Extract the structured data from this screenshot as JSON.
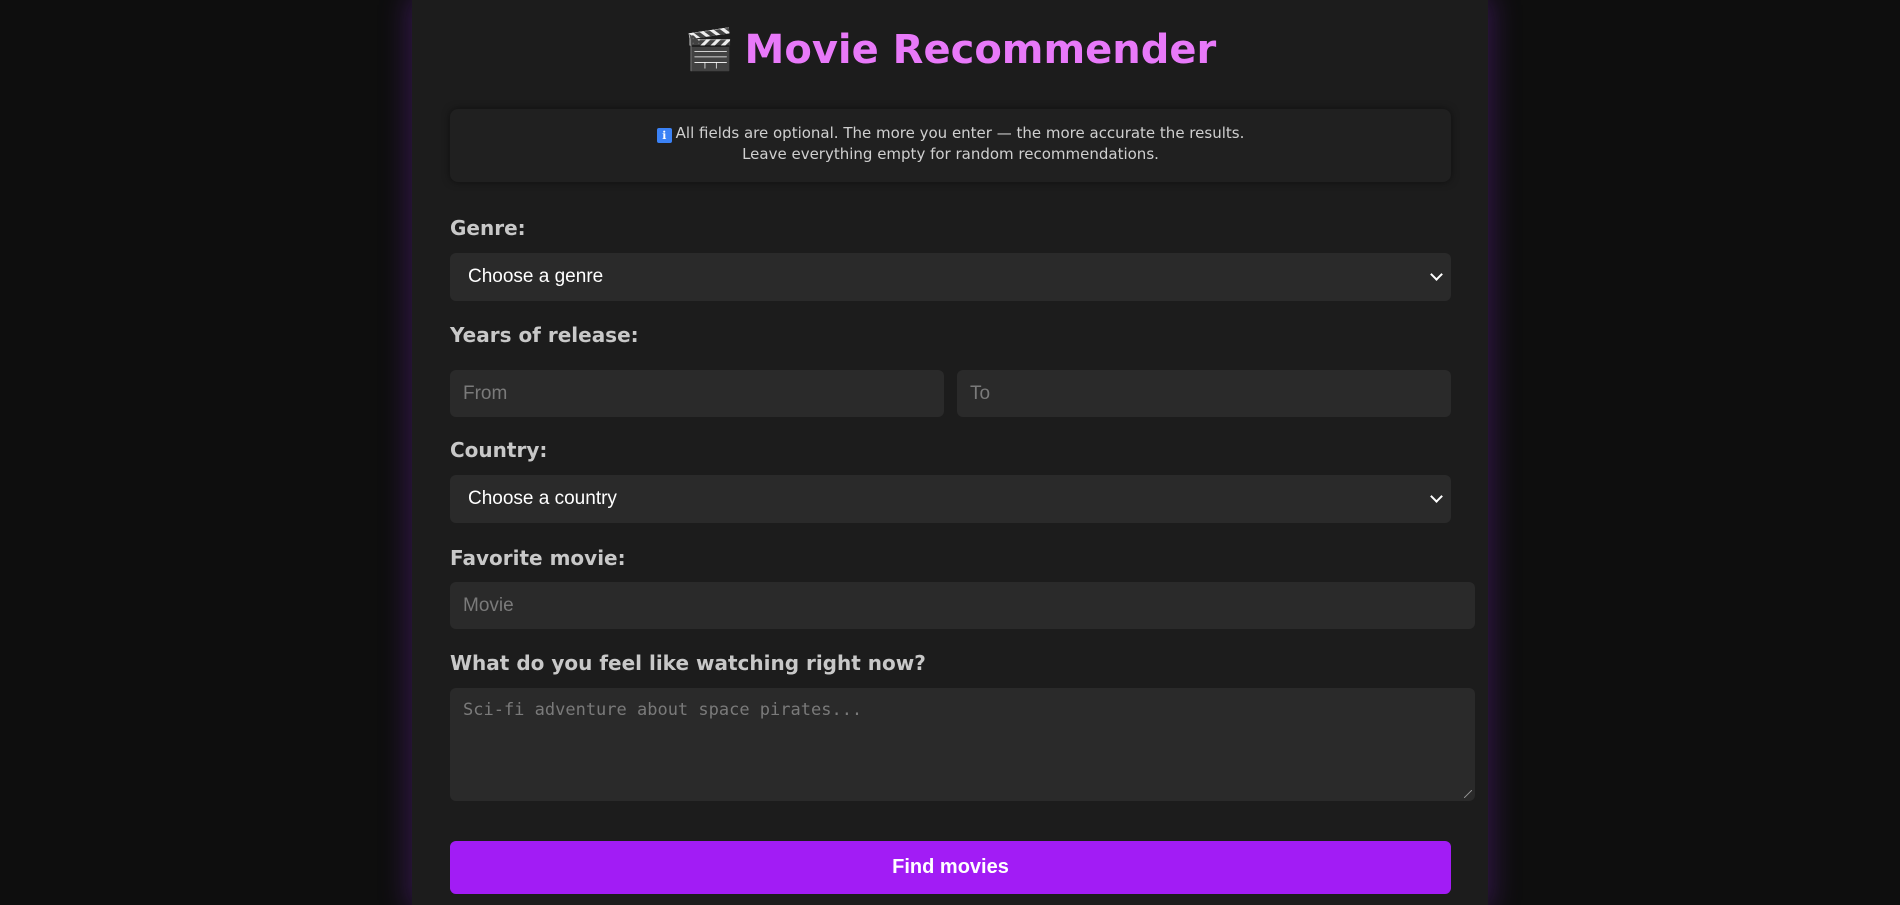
{
  "header": {
    "emoji": "🎬",
    "title": "Movie Recommender"
  },
  "info": {
    "icon": "ℹ",
    "line1": "All fields are optional. The more you enter — the more accurate the results.",
    "line2": "Leave everything empty for random recommendations."
  },
  "genre": {
    "label": "Genre:",
    "selected": "Choose a genre"
  },
  "years": {
    "label": "Years of release:",
    "from_placeholder": "From",
    "to_placeholder": "To"
  },
  "country": {
    "label": "Country:",
    "selected": "Choose a country"
  },
  "favorite": {
    "label": "Favorite movie:",
    "placeholder": "Movie"
  },
  "mood": {
    "label": "What do you feel like watching right now?",
    "placeholder": "Sci-fi adventure about space pirates..."
  },
  "submit": {
    "label": "Find movies"
  },
  "colors": {
    "title": "#e879f9",
    "button": "#a21cf5",
    "panel": "#1c1c1c",
    "background": "#0e0e0e",
    "info_icon": "#3b82f6"
  },
  "icons": {
    "title_icon": "clapper-board-icon",
    "info_icon": "info-icon",
    "select_arrow": "chevron-down-icon"
  }
}
